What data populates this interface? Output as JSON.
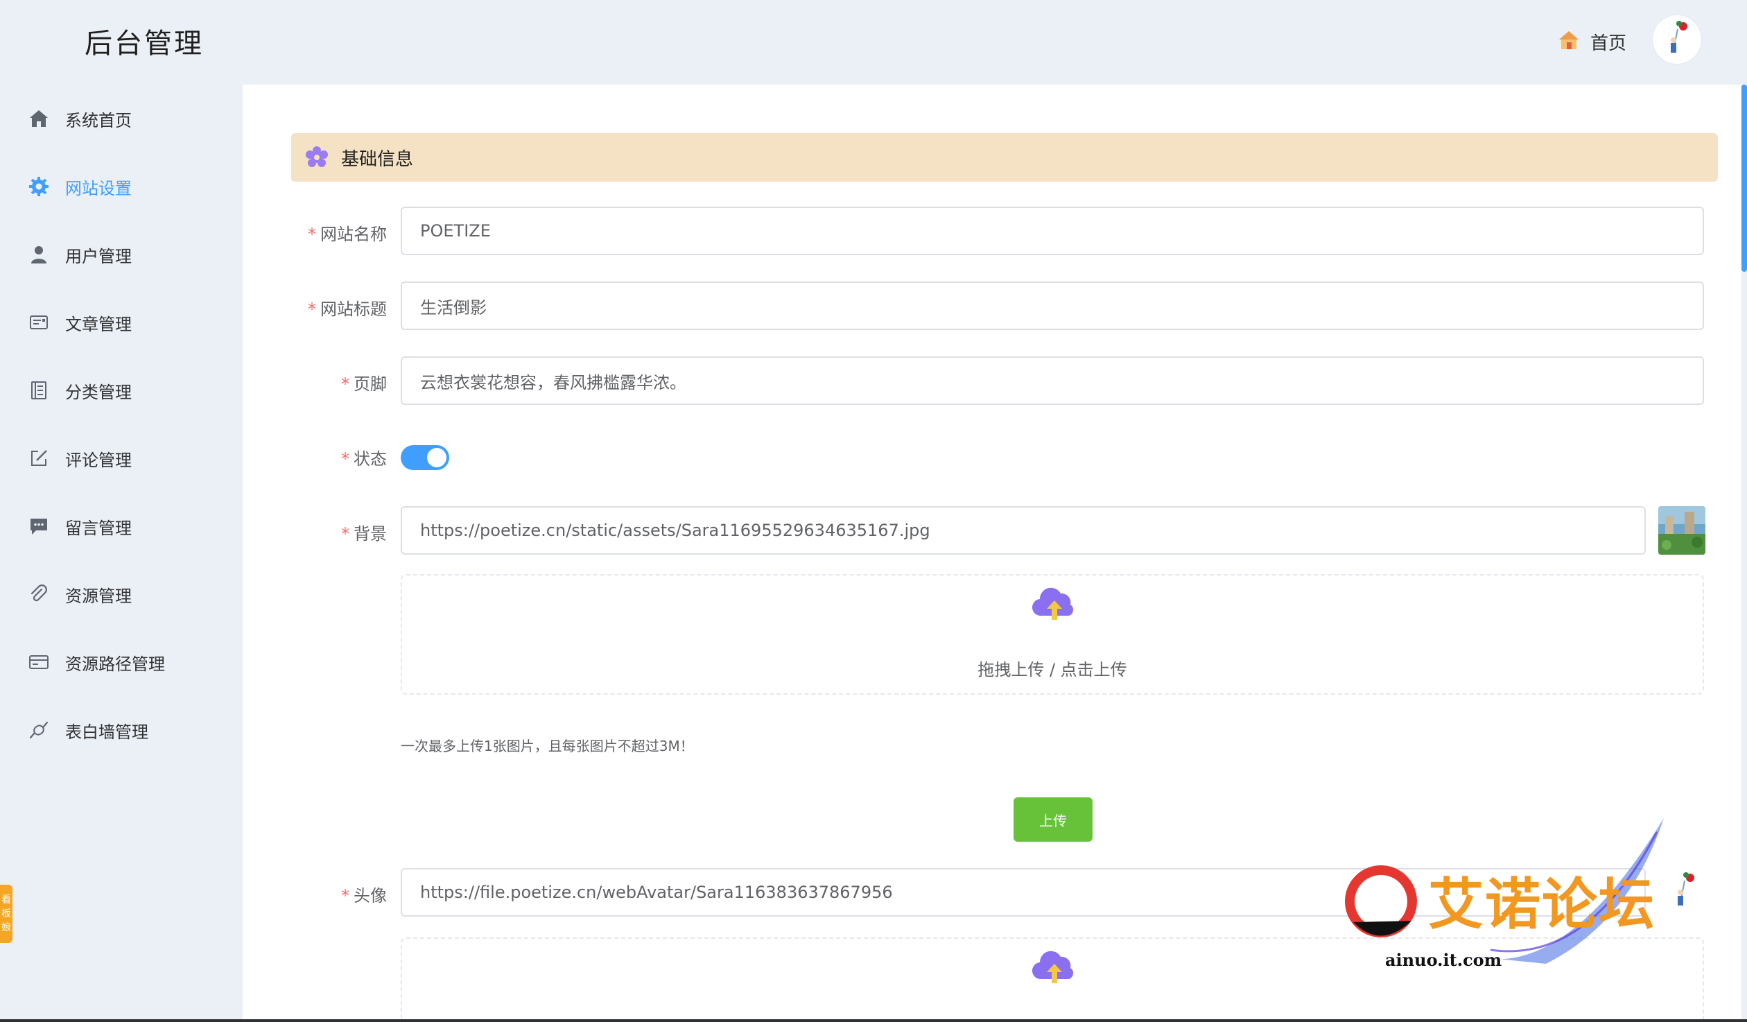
{
  "header": {
    "title": "后台管理",
    "home_label": "首页"
  },
  "sidebar": {
    "items": [
      {
        "label": "系统首页",
        "icon": "home-icon"
      },
      {
        "label": "网站设置",
        "icon": "gear-icon",
        "active": true
      },
      {
        "label": "用户管理",
        "icon": "user-icon"
      },
      {
        "label": "文章管理",
        "icon": "article-icon"
      },
      {
        "label": "分类管理",
        "icon": "category-icon"
      },
      {
        "label": "评论管理",
        "icon": "edit-icon"
      },
      {
        "label": "留言管理",
        "icon": "message-icon"
      },
      {
        "label": "资源管理",
        "icon": "paperclip-icon"
      },
      {
        "label": "资源路径管理",
        "icon": "card-icon"
      },
      {
        "label": "表白墙管理",
        "icon": "candy-icon"
      }
    ],
    "accent_color": "#409eff"
  },
  "section": {
    "title": "基础信息"
  },
  "form": {
    "site_name": {
      "label": "网站名称",
      "value": "POETIZE"
    },
    "site_title": {
      "label": "网站标题",
      "value": "生活倒影"
    },
    "footer": {
      "label": "页脚",
      "value": "云想衣裳花想容，春风拂槛露华浓。"
    },
    "status": {
      "label": "状态",
      "enabled": true
    },
    "background": {
      "label": "背景",
      "value": "https://poetize.cn/static/assets/Sara11695529634635167.jpg"
    },
    "avatar": {
      "label": "头像",
      "value": "https://file.poetize.cn/webAvatar/Sara116383637867956"
    },
    "required_mark": "*"
  },
  "upload": {
    "hint": "拖拽上传 / 点击上传",
    "tip": "一次最多上传1张图片，且每张图片不超过3M！",
    "button_label": "上传",
    "button_color": "#67c23a"
  },
  "side_tab": {
    "chars": [
      "看",
      "板",
      "娘"
    ]
  },
  "watermark": {
    "text": "艾诺论坛",
    "url": "ainuo.it.com"
  }
}
